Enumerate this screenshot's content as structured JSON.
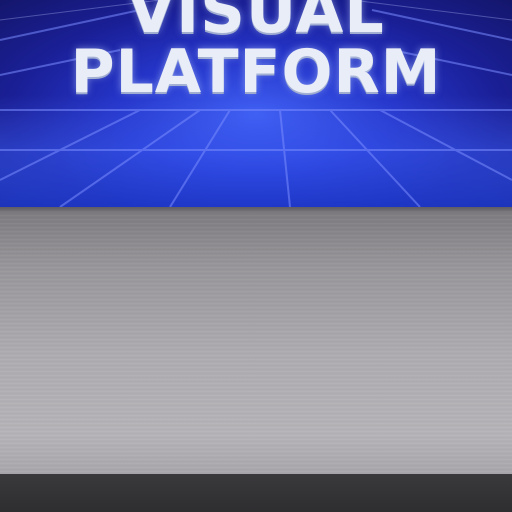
{
  "hero": {
    "title_line1": "VISUAL",
    "title_line2": "PLATFORM"
  },
  "colors": {
    "hero_blue": "#2535c9",
    "hero_dark": "#14166b",
    "title_white": "#e9edf7",
    "panel_gray": "#aeacb0",
    "footer_dark": "#2f2e31"
  }
}
